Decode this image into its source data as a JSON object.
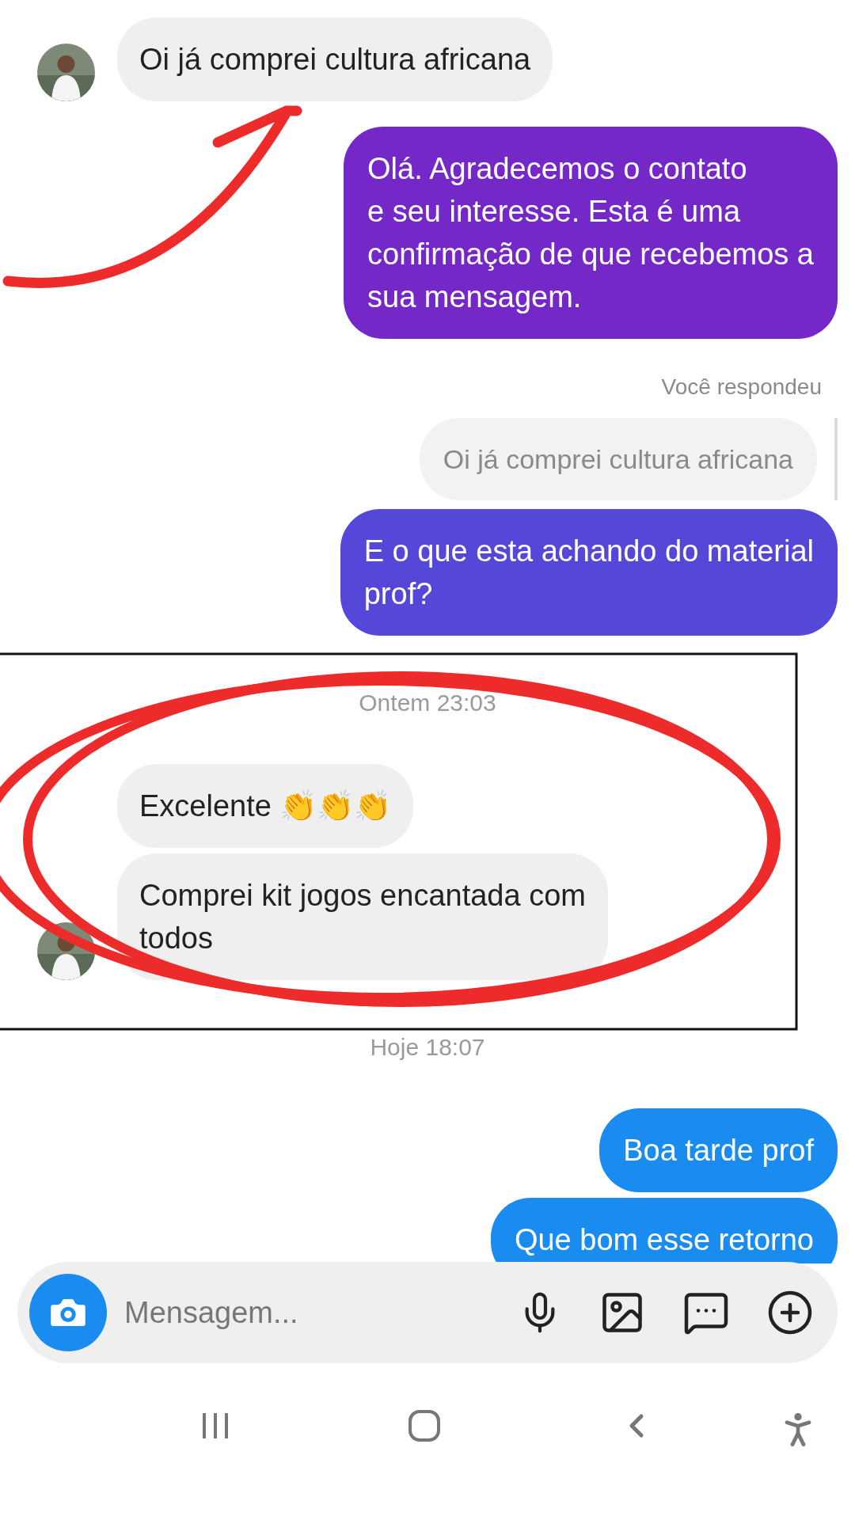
{
  "messages": [
    {
      "kind": "incoming",
      "text": "Oi já comprei cultura africana",
      "avatar": true
    },
    {
      "kind": "outgoing",
      "text": "Olá. Agradecemos o contato\ne seu interesse. Esta é uma\nconfirmação de que recebemos a\nsua mensagem.",
      "color": "#7428c8"
    },
    {
      "kind": "reply_label",
      "text": "Você respondeu"
    },
    {
      "kind": "quote",
      "text": "Oi já comprei cultura africana"
    },
    {
      "kind": "outgoing",
      "text": "E o que esta achando do material\nprof?",
      "color": "#5548d8"
    },
    {
      "kind": "timestamp",
      "text": "Ontem 23:03"
    },
    {
      "kind": "incoming",
      "text": "Excelente 👏👏👏",
      "avatar": false
    },
    {
      "kind": "incoming",
      "text": "Comprei kit jogos encantada com\ntodos",
      "avatar": true
    },
    {
      "kind": "timestamp",
      "text": "Hoje 18:07"
    },
    {
      "kind": "outgoing",
      "text": "Boa tarde prof",
      "color": "#1a8cf0"
    },
    {
      "kind": "outgoing",
      "text": "Que bom esse retorno",
      "color": "#1a8cf0"
    }
  ],
  "composer": {
    "placeholder": "Mensagem..."
  }
}
